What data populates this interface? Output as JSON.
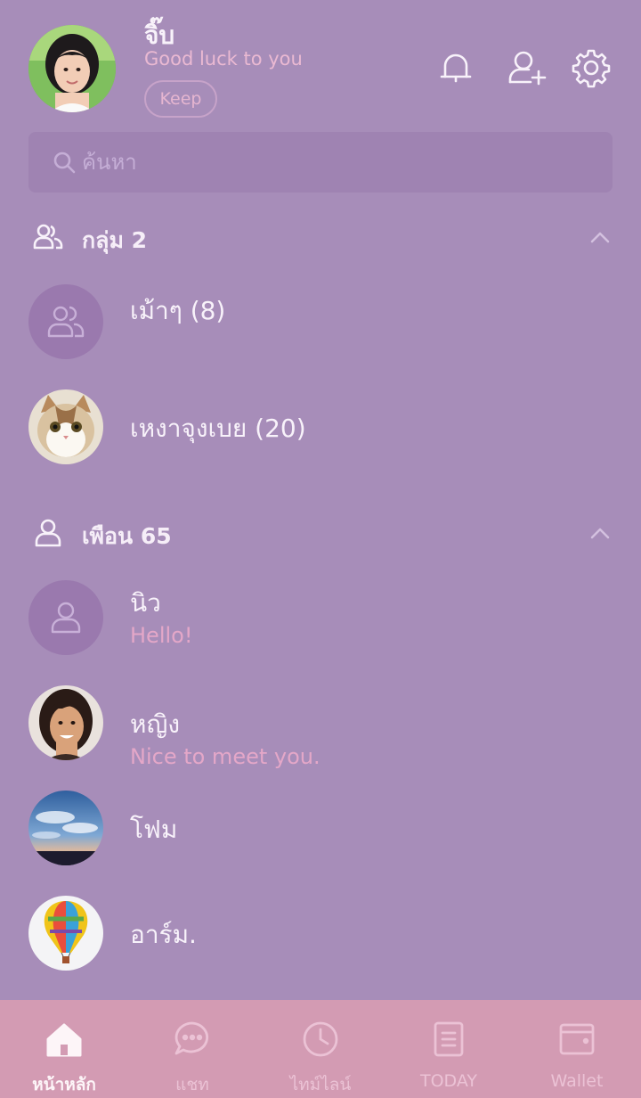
{
  "profile": {
    "name": "จิ๊บ",
    "status": "Good luck to you",
    "keep_label": "Keep"
  },
  "header_icons": [
    "bell-icon",
    "add-friend-icon",
    "settings-gear-icon"
  ],
  "search": {
    "placeholder": "ค้นหา"
  },
  "groups_section": {
    "title": "กลุ่ม 2",
    "items": [
      {
        "name": "เม้าๆ (8)",
        "avatar": "group-placeholder-icon"
      },
      {
        "name": "เหงาจุงเบย (20)",
        "avatar": "cat-photo"
      }
    ]
  },
  "friends_section": {
    "title": "เพือน 65",
    "items": [
      {
        "name": "นิว",
        "status": "Hello!",
        "avatar": "person-placeholder-icon"
      },
      {
        "name": "หญิง",
        "status": "Nice to meet you.",
        "avatar": "woman-photo"
      },
      {
        "name": "โฟม",
        "avatar": "sky-photo"
      },
      {
        "name": "อาร์ม.",
        "avatar": "hot-air-balloon-photo"
      }
    ]
  },
  "tabs": [
    {
      "label": "หน้าหลัก",
      "icon": "home-icon",
      "active": true
    },
    {
      "label": "แชท",
      "icon": "chat-icon",
      "active": false
    },
    {
      "label": "ไทม์ไลน์",
      "icon": "clock-icon",
      "active": false
    },
    {
      "label": "TODAY",
      "icon": "news-icon",
      "active": false
    },
    {
      "label": "Wallet",
      "icon": "wallet-icon",
      "active": false
    }
  ],
  "colors": {
    "background": "#a78db9",
    "search_bg": "#9f83b2",
    "tabbar_bg": "#d39bb3",
    "status_pink": "#e4a7c8"
  }
}
